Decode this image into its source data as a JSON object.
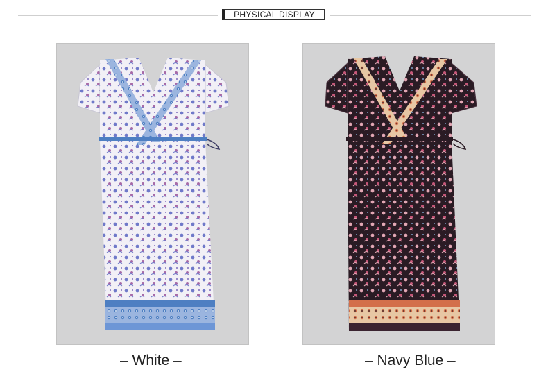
{
  "section_title": "PHYSICAL DISPLAY",
  "products": [
    {
      "caption": "– White –",
      "colors": {
        "base": "#f2f0f6",
        "motif": "#6f79c9",
        "accent": "#a66aa8",
        "band": "#4e7fc2",
        "band2": "#9bb5df",
        "hem": "#6d96d6"
      }
    },
    {
      "caption": "– Navy Blue –",
      "colors": {
        "base": "#2a1b24",
        "motif": "#e2a7b4",
        "accent": "#c8587a",
        "band": "#d36f4a",
        "band2": "#e7c7a4",
        "hem": "#3a2330"
      }
    }
  ]
}
